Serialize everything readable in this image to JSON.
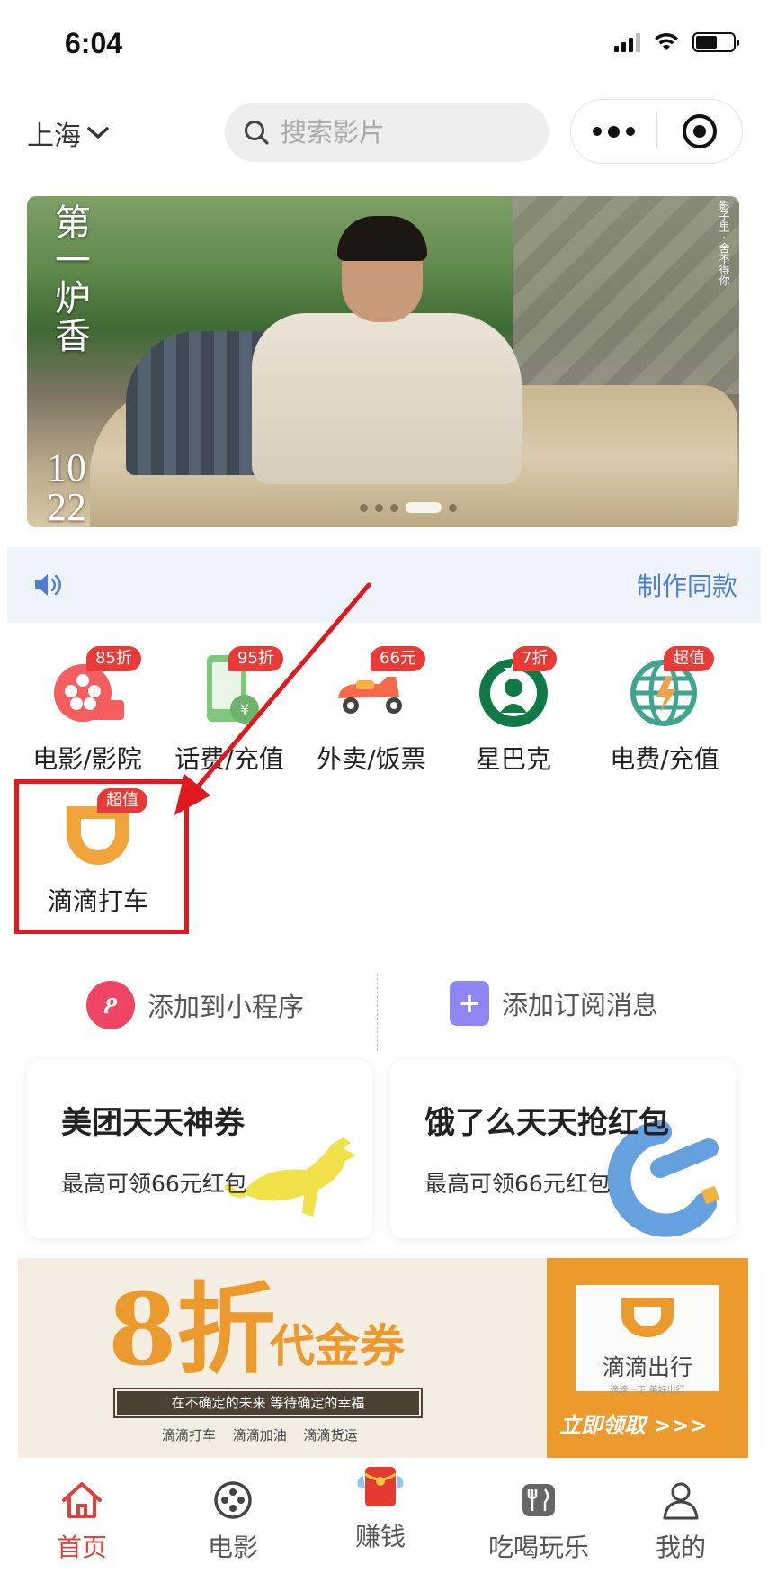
{
  "status_bar": {
    "time": "6:04"
  },
  "header": {
    "city": "上海",
    "search_placeholder": "搜索影片"
  },
  "banner": {
    "poster_title": "第一炉香",
    "poster_date_line1": "10",
    "poster_date_line2": "22",
    "side_text": "影子里 · 舍不得你",
    "slide_count": 5,
    "active_slide": 3
  },
  "notice": {
    "icon": "speaker-icon",
    "action_label": "制作同款"
  },
  "services": [
    {
      "label": "电影/影院",
      "badge": "85折",
      "icon": "film-reel-icon"
    },
    {
      "label": "话费/充值",
      "badge": "95折",
      "icon": "phone-recharge-icon"
    },
    {
      "label": "外卖/饭票",
      "badge": "66元",
      "icon": "scooter-icon"
    },
    {
      "label": "星巴克",
      "badge": "7折",
      "icon": "starbucks-icon"
    },
    {
      "label": "电费/充值",
      "badge": "超值",
      "icon": "globe-power-icon"
    },
    {
      "label": "滴滴打车",
      "badge": "超值",
      "icon": "didi-icon"
    }
  ],
  "add_row": {
    "mini_program": "添加到小程序",
    "subscribe": "添加订阅消息"
  },
  "cards": [
    {
      "title": "美团天天神券",
      "subtitle": "最高可领66元红包",
      "icon": "kangaroo-icon"
    },
    {
      "title": "饿了么天天抢红包",
      "subtitle": "最高可领66元红包",
      "icon": "eleme-icon"
    }
  ],
  "didi_banner": {
    "discount": "8折",
    "voucher": "代金券",
    "slogan": "在不确定的未来  等待确定的幸福",
    "services": "滴滴打车  滴滴加油  滴滴货运",
    "brand": "滴滴出行",
    "brand_tagline": "滴滴一下 美好出行",
    "cta": "立即领取 >>>",
    "accent_color": "#ec9a2c"
  },
  "tabbar": [
    {
      "label": "首页",
      "icon": "home-icon",
      "active": true
    },
    {
      "label": "电影",
      "icon": "film-icon",
      "active": false
    },
    {
      "label": "赚钱",
      "icon": "red-envelope-icon",
      "active": false
    },
    {
      "label": "吃喝玩乐",
      "icon": "dining-icon",
      "active": false
    },
    {
      "label": "我的",
      "icon": "profile-icon",
      "active": false
    }
  ],
  "colors": {
    "highlight_red": "#e0191e",
    "badge_red": "#e83a36",
    "link_blue": "#4a7fd4",
    "tab_active": "#e23f3f"
  }
}
